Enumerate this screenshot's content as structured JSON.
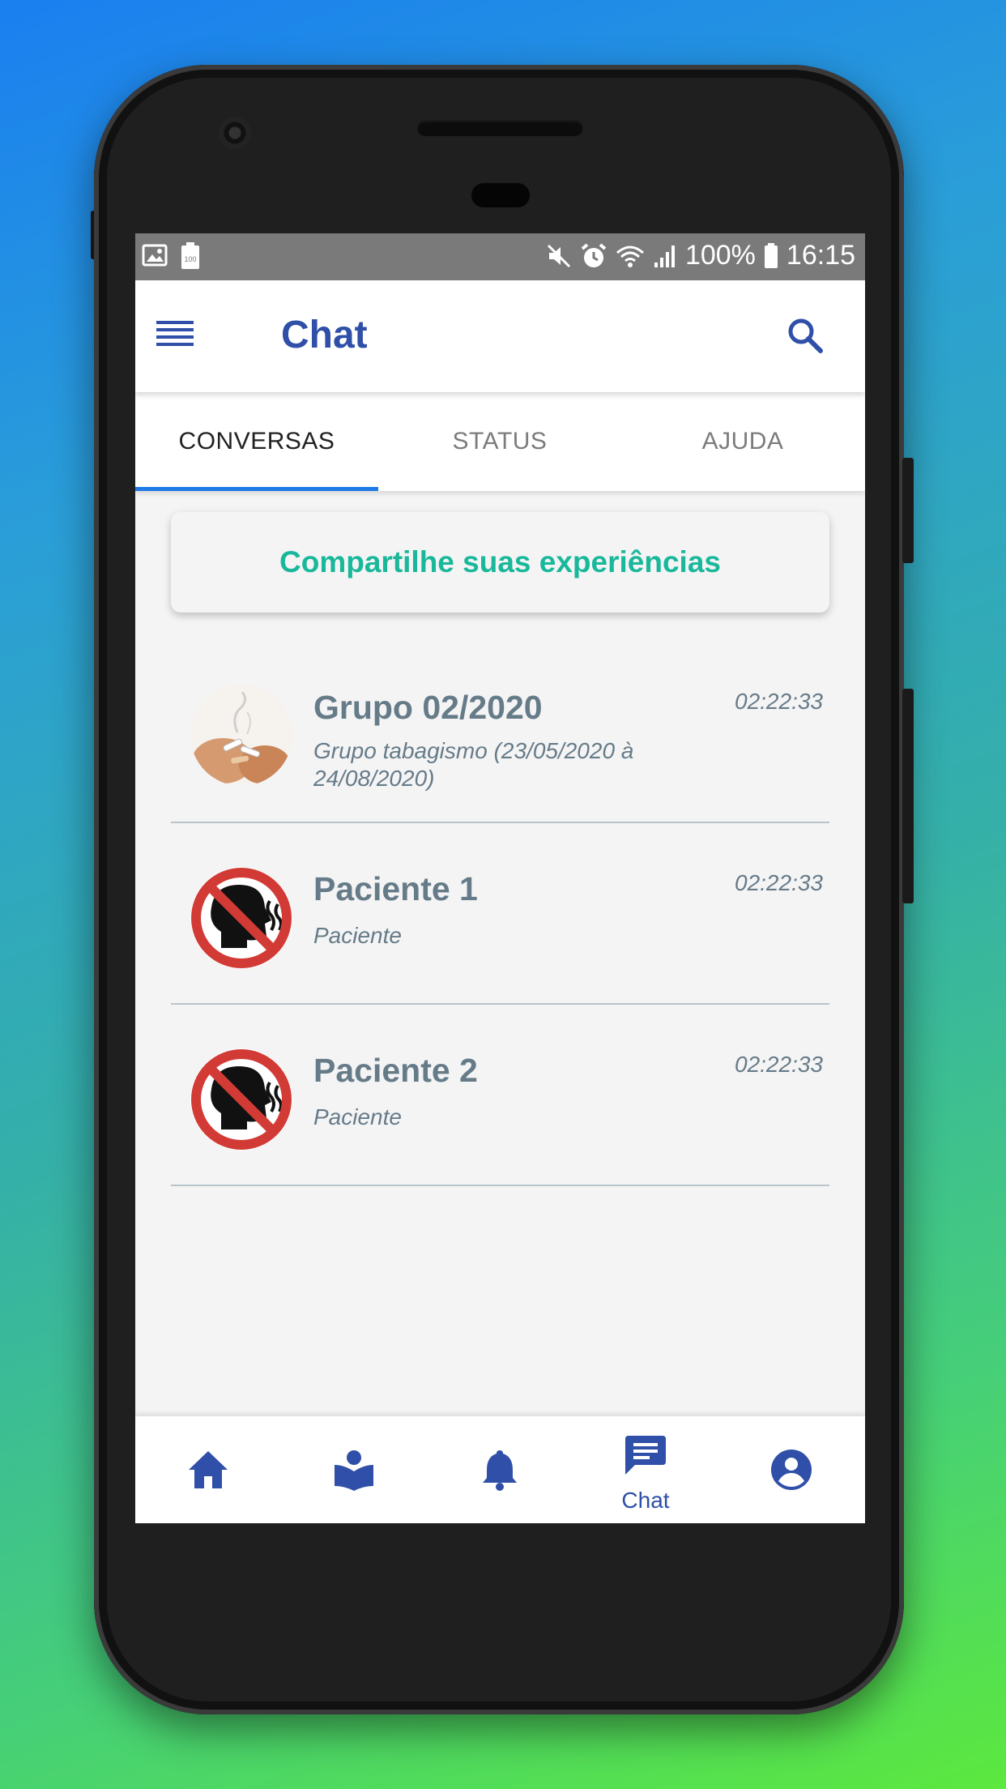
{
  "status_bar": {
    "battery_percent": "100%",
    "time": "16:15"
  },
  "app_bar": {
    "title": "Chat"
  },
  "tabs": [
    {
      "label": "CONVERSAS",
      "active": true
    },
    {
      "label": "STATUS",
      "active": false
    },
    {
      "label": "AJUDA",
      "active": false
    }
  ],
  "share_card": {
    "label": "Compartilhe suas experiências"
  },
  "conversations": [
    {
      "name": "Grupo 02/2020",
      "subtitle": "Grupo tabagismo (23/05/2020 à 24/08/2020)",
      "time": "02:22:33",
      "avatar_icon": "group-photo-icon"
    },
    {
      "name": "Paciente 1",
      "subtitle": "Paciente",
      "time": "02:22:33",
      "avatar_icon": "no-smoking-icon"
    },
    {
      "name": "Paciente 2",
      "subtitle": "Paciente",
      "time": "02:22:33",
      "avatar_icon": "no-smoking-icon"
    }
  ],
  "bottom_nav": {
    "items": [
      {
        "icon": "home-icon"
      },
      {
        "icon": "reading-icon"
      },
      {
        "icon": "bell-icon"
      },
      {
        "icon": "chat-icon",
        "label": "Chat",
        "active": true
      },
      {
        "icon": "account-icon"
      }
    ]
  },
  "colors": {
    "primary": "#2f4fa8",
    "accent_text": "#1ab89b",
    "tab_indicator": "#1e7ae6",
    "muted_text": "#667b88"
  }
}
